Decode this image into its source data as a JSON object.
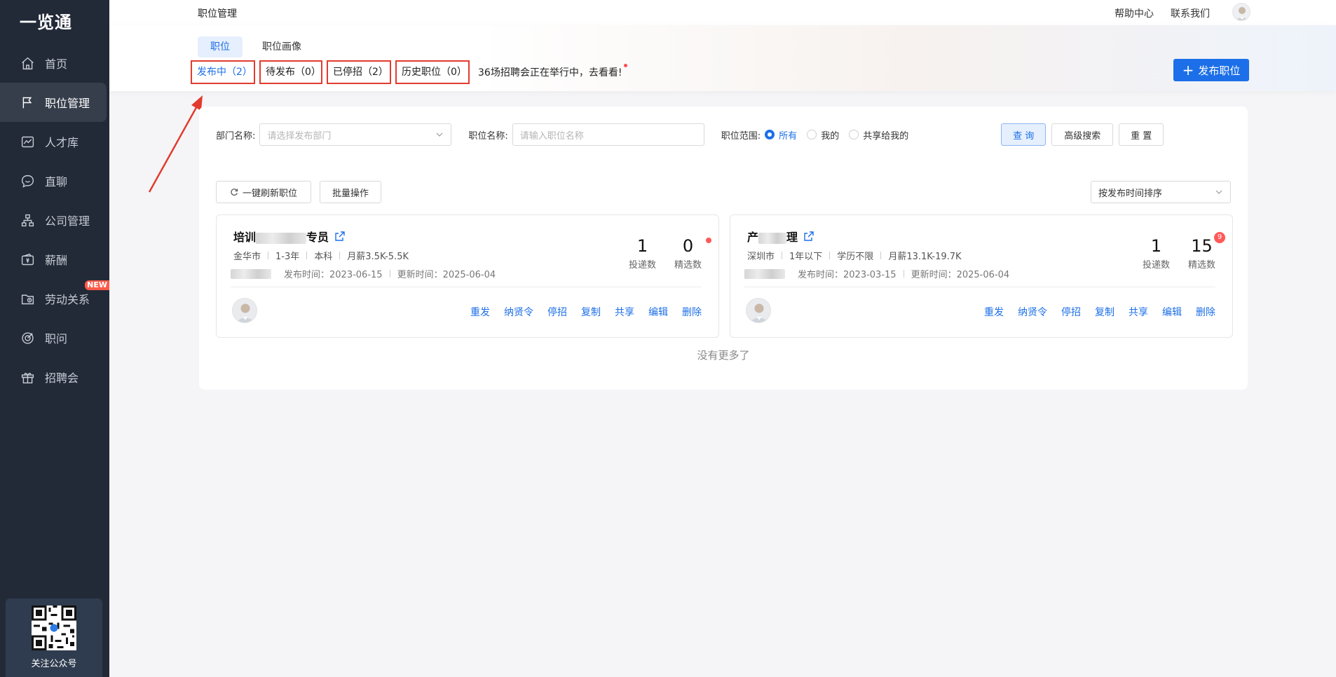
{
  "app": {
    "logo": "一览通"
  },
  "sidebar": {
    "items": [
      {
        "label": "首页",
        "icon": "home-icon"
      },
      {
        "label": "职位管理",
        "icon": "flag-icon",
        "active": true
      },
      {
        "label": "人才库",
        "icon": "chart-icon"
      },
      {
        "label": "直聊",
        "icon": "chat-icon"
      },
      {
        "label": "公司管理",
        "icon": "org-icon"
      },
      {
        "label": "薪酬",
        "icon": "wallet-icon"
      },
      {
        "label": "劳动关系",
        "icon": "folder-icon",
        "badge": "NEW"
      },
      {
        "label": "职问",
        "icon": "target-icon"
      },
      {
        "label": "招聘会",
        "icon": "gift-icon"
      }
    ],
    "qr_label": "关注公众号"
  },
  "topbar": {
    "breadcrumb": "职位管理",
    "help": "帮助中心",
    "contact": "联系我们"
  },
  "header": {
    "subtabs": [
      "职位",
      "职位画像"
    ],
    "status_tabs": [
      "发布中（2）",
      "待发布（0）",
      "已停招（2）",
      "历史职位（0）"
    ],
    "fair_notice": "36场招聘会正在举行中，去看看!",
    "publish_button": "发布职位"
  },
  "filters": {
    "dept_label": "部门名称:",
    "dept_placeholder": "请选择发布部门",
    "job_label": "职位名称:",
    "job_placeholder": "请输入职位名称",
    "scope_label": "职位范围:",
    "scope_options": [
      "所有",
      "我的",
      "共享给我的"
    ],
    "search_btn": "查 询",
    "advanced_btn": "高级搜索",
    "reset_btn": "重 置"
  },
  "toolbar": {
    "refresh_btn": "一键刷新职位",
    "batch_btn": "批量操作",
    "sort": "按发布时间排序"
  },
  "jobs": [
    {
      "title_prefix": "培训",
      "title_suffix": "专员",
      "city": "金华市",
      "experience": "1-3年",
      "education": "本科",
      "salary": "月薪3.5K-5.5K",
      "published": "发布时间：2023-06-15",
      "updated": "更新时间：2025-06-04",
      "applications": "1",
      "applications_label": "投递数",
      "selected": "0",
      "selected_label": "精选数"
    },
    {
      "title_prefix": "产",
      "title_suffix": "理",
      "city": "深圳市",
      "experience": "1年以下",
      "education": "学历不限",
      "salary": "月薪13.1K-19.7K",
      "published": "发布时间：2023-03-15",
      "updated": "更新时间：2025-06-04",
      "applications": "1",
      "applications_label": "投递数",
      "selected": "15",
      "selected_label": "精选数",
      "selected_badge": "9"
    }
  ],
  "card_actions": [
    "重发",
    "纳贤令",
    "停招",
    "复制",
    "共享",
    "编辑",
    "删除"
  ],
  "no_more": "没有更多了",
  "colors": {
    "primary": "#1c6fe8",
    "sidebar": "#222a37",
    "highlight": "#e23b2e"
  }
}
